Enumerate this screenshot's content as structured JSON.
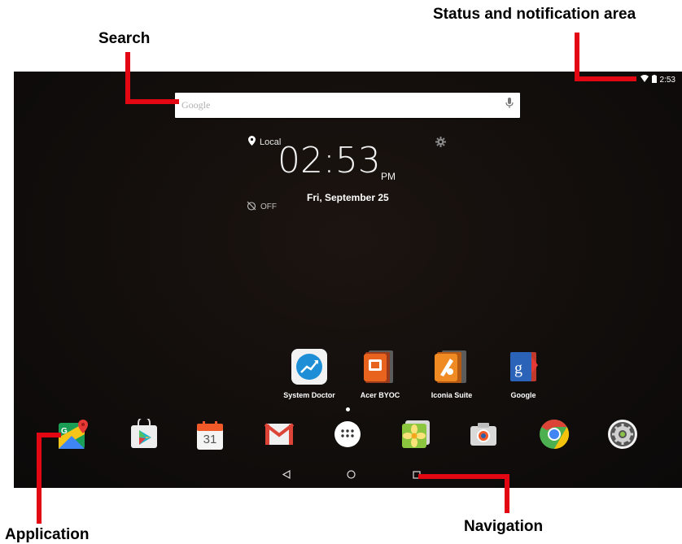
{
  "callouts": {
    "status": "Status and notification area",
    "search": "Search",
    "application": "Application",
    "navigation": "Navigation"
  },
  "status_bar": {
    "time": "2:53",
    "icons": [
      "wifi-icon",
      "battery-icon"
    ]
  },
  "search": {
    "placeholder": "Google",
    "mic_icon": "mic-icon"
  },
  "clock": {
    "location": "Local",
    "time": "02:53",
    "ampm": "PM",
    "date": "Fri, September 25",
    "alarm": "OFF"
  },
  "apps": [
    {
      "label": "System Doctor",
      "icon": "system-doctor-icon"
    },
    {
      "label": "Acer BYOC",
      "icon": "acer-byoc-icon"
    },
    {
      "label": "Iconia Suite",
      "icon": "iconia-suite-icon"
    },
    {
      "label": "Google",
      "icon": "google-folder-icon"
    }
  ],
  "dock": [
    {
      "icon": "maps-icon"
    },
    {
      "icon": "play-store-icon"
    },
    {
      "icon": "calendar-icon",
      "text": "31"
    },
    {
      "icon": "gmail-icon"
    },
    {
      "icon": "app-drawer-icon"
    },
    {
      "icon": "gallery-icon"
    },
    {
      "icon": "camera-icon"
    },
    {
      "icon": "chrome-icon"
    },
    {
      "icon": "settings-icon"
    }
  ],
  "navigation": [
    "back-icon",
    "home-icon",
    "recents-icon"
  ],
  "colors": {
    "callout_line": "#e30613",
    "wallpaper": "#120e0c"
  }
}
